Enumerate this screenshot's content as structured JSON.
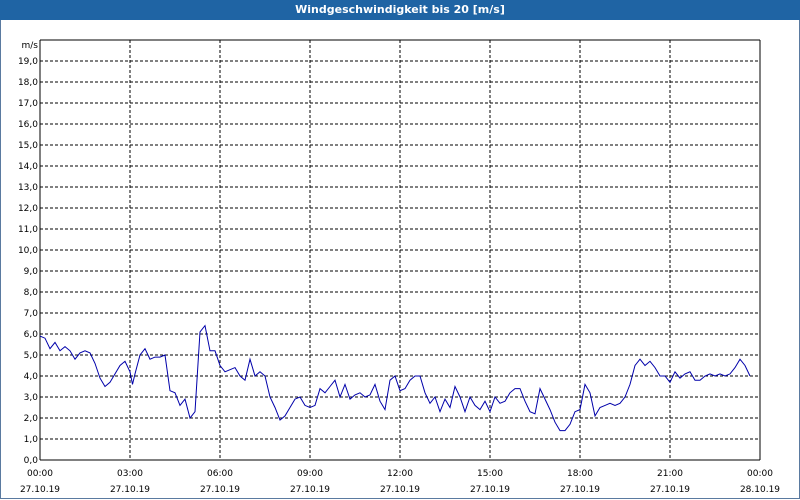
{
  "window": {
    "title": "Windgeschwindigkeit bis 20 [m/s]"
  },
  "chart_data": {
    "type": "line",
    "title": "Windgeschwindigkeit bis 20 [m/s]",
    "ylabel": "m/s",
    "xlabel": "",
    "ylim": [
      0,
      20
    ],
    "xlim": [
      "27.10.19 00:00",
      "28.10.19 00:00"
    ],
    "grid": true,
    "y_ticks": [
      "0,0",
      "1,0",
      "2,0",
      "3,0",
      "4,0",
      "5,0",
      "6,0",
      "7,0",
      "8,0",
      "9,0",
      "10,0",
      "11,0",
      "12,0",
      "13,0",
      "14,0",
      "15,0",
      "16,0",
      "17,0",
      "18,0",
      "19,0"
    ],
    "x_ticks": [
      {
        "time": "00:00",
        "date": "27.10.19"
      },
      {
        "time": "03:00",
        "date": "27.10.19"
      },
      {
        "time": "06:00",
        "date": "27.10.19"
      },
      {
        "time": "09:00",
        "date": "27.10.19"
      },
      {
        "time": "12:00",
        "date": "27.10.19"
      },
      {
        "time": "15:00",
        "date": "27.10.19"
      },
      {
        "time": "18:00",
        "date": "27.10.19"
      },
      {
        "time": "21:00",
        "date": "27.10.19"
      },
      {
        "time": "00:00",
        "date": "28.10.19"
      }
    ],
    "series": [
      {
        "color": "#0000aa",
        "points": [
          [
            "27.10.19 00:00",
            5.9
          ],
          [
            "27.10.19 00:10",
            5.8
          ],
          [
            "27.10.19 00:20",
            5.3
          ],
          [
            "27.10.19 00:30",
            5.6
          ],
          [
            "27.10.19 00:40",
            5.2
          ],
          [
            "27.10.19 00:50",
            5.4
          ],
          [
            "27.10.19 01:00",
            5.2
          ],
          [
            "27.10.19 01:10",
            4.8
          ],
          [
            "27.10.19 01:20",
            5.1
          ],
          [
            "27.10.19 01:30",
            5.2
          ],
          [
            "27.10.19 01:40",
            5.1
          ],
          [
            "27.10.19 01:50",
            4.6
          ],
          [
            "27.10.19 02:00",
            3.9
          ],
          [
            "27.10.19 02:10",
            3.5
          ],
          [
            "27.10.19 02:20",
            3.7
          ],
          [
            "27.10.19 02:30",
            4.1
          ],
          [
            "27.10.19 02:40",
            4.5
          ],
          [
            "27.10.19 02:50",
            4.7
          ],
          [
            "27.10.19 03:00",
            4.2
          ],
          [
            "27.10.19 03:05",
            3.6
          ],
          [
            "27.10.19 03:10",
            4.1
          ],
          [
            "27.10.19 03:20",
            5.0
          ],
          [
            "27.10.19 03:30",
            5.3
          ],
          [
            "27.10.19 03:40",
            4.8
          ],
          [
            "27.10.19 03:50",
            4.9
          ],
          [
            "27.10.19 04:00",
            4.9
          ],
          [
            "27.10.19 04:10",
            5.0
          ],
          [
            "27.10.19 04:20",
            3.3
          ],
          [
            "27.10.19 04:30",
            3.2
          ],
          [
            "27.10.19 04:40",
            2.6
          ],
          [
            "27.10.19 04:50",
            2.9
          ],
          [
            "27.10.19 05:00",
            2.0
          ],
          [
            "27.10.19 05:10",
            2.3
          ],
          [
            "27.10.19 05:20",
            6.1
          ],
          [
            "27.10.19 05:30",
            6.4
          ],
          [
            "27.10.19 05:40",
            5.2
          ],
          [
            "27.10.19 05:50",
            5.2
          ],
          [
            "27.10.19 06:00",
            4.5
          ],
          [
            "27.10.19 06:10",
            4.2
          ],
          [
            "27.10.19 06:20",
            4.3
          ],
          [
            "27.10.19 06:30",
            4.4
          ],
          [
            "27.10.19 06:40",
            4.0
          ],
          [
            "27.10.19 06:50",
            3.8
          ],
          [
            "27.10.19 07:00",
            4.8
          ],
          [
            "27.10.19 07:10",
            4.0
          ],
          [
            "27.10.19 07:20",
            4.2
          ],
          [
            "27.10.19 07:30",
            4.0
          ],
          [
            "27.10.19 07:40",
            3.0
          ],
          [
            "27.10.19 07:50",
            2.5
          ],
          [
            "27.10.19 08:00",
            1.9
          ],
          [
            "27.10.19 08:10",
            2.1
          ],
          [
            "27.10.19 08:20",
            2.5
          ],
          [
            "27.10.19 08:30",
            2.9
          ],
          [
            "27.10.19 08:40",
            3.0
          ],
          [
            "27.10.19 08:50",
            2.6
          ],
          [
            "27.10.19 09:00",
            2.5
          ],
          [
            "27.10.19 09:10",
            2.6
          ],
          [
            "27.10.19 09:20",
            3.4
          ],
          [
            "27.10.19 09:30",
            3.2
          ],
          [
            "27.10.19 09:40",
            3.5
          ],
          [
            "27.10.19 09:50",
            3.8
          ],
          [
            "27.10.19 10:00",
            3.0
          ],
          [
            "27.10.19 10:10",
            3.6
          ],
          [
            "27.10.19 10:20",
            2.9
          ],
          [
            "27.10.19 10:30",
            3.1
          ],
          [
            "27.10.19 10:40",
            3.2
          ],
          [
            "27.10.19 10:50",
            3.0
          ],
          [
            "27.10.19 11:00",
            3.1
          ],
          [
            "27.10.19 11:10",
            3.6
          ],
          [
            "27.10.19 11:20",
            2.8
          ],
          [
            "27.10.19 11:30",
            2.4
          ],
          [
            "27.10.19 11:40",
            3.8
          ],
          [
            "27.10.19 11:50",
            4.0
          ],
          [
            "27.10.19 12:00",
            3.3
          ],
          [
            "27.10.19 12:10",
            3.4
          ],
          [
            "27.10.19 12:20",
            3.8
          ],
          [
            "27.10.19 12:30",
            4.0
          ],
          [
            "27.10.19 12:40",
            4.0
          ],
          [
            "27.10.19 12:50",
            3.2
          ],
          [
            "27.10.19 13:00",
            2.7
          ],
          [
            "27.10.19 13:10",
            3.0
          ],
          [
            "27.10.19 13:20",
            2.3
          ],
          [
            "27.10.19 13:30",
            2.9
          ],
          [
            "27.10.19 13:40",
            2.5
          ],
          [
            "27.10.19 13:50",
            3.5
          ],
          [
            "27.10.19 14:00",
            3.0
          ],
          [
            "27.10.19 14:10",
            2.3
          ],
          [
            "27.10.19 14:20",
            3.0
          ],
          [
            "27.10.19 14:30",
            2.6
          ],
          [
            "27.10.19 14:40",
            2.4
          ],
          [
            "27.10.19 14:50",
            2.8
          ],
          [
            "27.10.19 15:00",
            2.3
          ],
          [
            "27.10.19 15:10",
            3.0
          ],
          [
            "27.10.19 15:20",
            2.7
          ],
          [
            "27.10.19 15:30",
            2.8
          ],
          [
            "27.10.19 15:40",
            3.2
          ],
          [
            "27.10.19 15:50",
            3.4
          ],
          [
            "27.10.19 16:00",
            3.4
          ],
          [
            "27.10.19 16:10",
            2.8
          ],
          [
            "27.10.19 16:20",
            2.3
          ],
          [
            "27.10.19 16:30",
            2.2
          ],
          [
            "27.10.19 16:40",
            3.4
          ],
          [
            "27.10.19 16:50",
            2.9
          ],
          [
            "27.10.19 17:00",
            2.4
          ],
          [
            "27.10.19 17:10",
            1.8
          ],
          [
            "27.10.19 17:20",
            1.4
          ],
          [
            "27.10.19 17:30",
            1.4
          ],
          [
            "27.10.19 17:40",
            1.7
          ],
          [
            "27.10.19 17:50",
            2.3
          ],
          [
            "27.10.19 18:00",
            2.4
          ],
          [
            "27.10.19 18:10",
            3.6
          ],
          [
            "27.10.19 18:20",
            3.2
          ],
          [
            "27.10.19 18:30",
            2.1
          ],
          [
            "27.10.19 18:40",
            2.5
          ],
          [
            "27.10.19 18:50",
            2.6
          ],
          [
            "27.10.19 19:00",
            2.7
          ],
          [
            "27.10.19 19:10",
            2.6
          ],
          [
            "27.10.19 19:20",
            2.7
          ],
          [
            "27.10.19 19:30",
            3.0
          ],
          [
            "27.10.19 19:40",
            3.6
          ],
          [
            "27.10.19 19:50",
            4.5
          ],
          [
            "27.10.19 20:00",
            4.8
          ],
          [
            "27.10.19 20:10",
            4.5
          ],
          [
            "27.10.19 20:20",
            4.7
          ],
          [
            "27.10.19 20:30",
            4.4
          ],
          [
            "27.10.19 20:40",
            4.0
          ],
          [
            "27.10.19 20:50",
            4.0
          ],
          [
            "27.10.19 21:00",
            3.7
          ],
          [
            "27.10.19 21:10",
            4.2
          ],
          [
            "27.10.19 21:20",
            3.9
          ],
          [
            "27.10.19 21:30",
            4.1
          ],
          [
            "27.10.19 21:40",
            4.2
          ],
          [
            "27.10.19 21:50",
            3.8
          ],
          [
            "27.10.19 22:00",
            3.8
          ],
          [
            "27.10.19 22:10",
            4.0
          ],
          [
            "27.10.19 22:20",
            4.1
          ],
          [
            "27.10.19 22:30",
            4.0
          ],
          [
            "27.10.19 22:40",
            4.1
          ],
          [
            "27.10.19 22:50",
            4.0
          ],
          [
            "27.10.19 23:00",
            4.1
          ],
          [
            "27.10.19 23:10",
            4.4
          ],
          [
            "27.10.19 23:20",
            4.8
          ],
          [
            "27.10.19 23:30",
            4.5
          ],
          [
            "27.10.19 23:40",
            4.0
          ]
        ]
      }
    ]
  }
}
